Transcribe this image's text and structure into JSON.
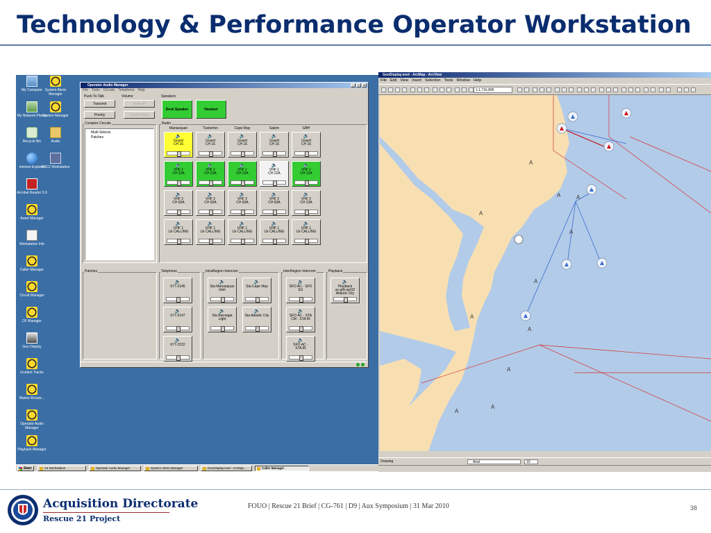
{
  "slide": {
    "title": "Technology & Performance Operator Workstation",
    "footer": "FOUO | Rescue 21 Brief | CG-761 | D9 | Aux Symposium | 31 Mar 2010",
    "page_number": "38",
    "org_name": "Acquisition Directorate",
    "org_sub": "Rescue 21 Project"
  },
  "desktop": {
    "icons": [
      {
        "label": "My Computer",
        "icon": "computer-icon"
      },
      {
        "label": "System Alerts Manager",
        "icon": "gear-icon"
      },
      {
        "label": "My Network Places",
        "icon": "network-icon"
      },
      {
        "label": "System Manager",
        "icon": "gear-icon"
      },
      {
        "label": "Recycle Bin",
        "icon": "recycle-bin-icon"
      },
      {
        "label": "Audio",
        "icon": "folder-icon"
      },
      {
        "label": "Internet Explorer",
        "icon": "ie-icon"
      },
      {
        "label": "DSC2 Workstation",
        "icon": "dsc-icon"
      },
      {
        "label": "Acrobat Reader 5.0",
        "icon": "acrobat-icon"
      },
      {
        "label": "Asset Manager",
        "icon": "gear-icon"
      },
      {
        "label": "Workstation Info",
        "icon": "document-icon"
      },
      {
        "label": "Caller Manager",
        "icon": "gear-icon"
      },
      {
        "label": "Circuit Manager",
        "icon": "gear-icon"
      },
      {
        "label": "DF Manager",
        "icon": "gear-icon"
      },
      {
        "label": "Geo Display",
        "icon": "geo-display-icon"
      },
      {
        "label": "Incident Tracks",
        "icon": "gear-icon"
      },
      {
        "label": "Marine Broadc...",
        "icon": "gear-icon"
      },
      {
        "label": "Operator Audio Manager",
        "icon": "gear-icon"
      },
      {
        "label": "Playback Manager",
        "icon": "gear-icon"
      }
    ]
  },
  "oam": {
    "title": "Operator Audio Manager",
    "menu": [
      "File",
      "Tools",
      "Circuits",
      "Telephone",
      "Help"
    ],
    "ptt_label": "Push-To-Talk",
    "transmit": "Transmit",
    "priority": "Priority",
    "volume_label": "Volume",
    "mute_all": "Mute All",
    "cancel_mute": "Cancel Mute",
    "speakers_label": "Speakers",
    "desk_speaker": "Desk Speaker",
    "headset": "Headset",
    "complex_label": "Complex Circuits",
    "tree": [
      "Multi Selects",
      "Patches"
    ],
    "radio_label": "Radio",
    "radio_cols": [
      "Manasquan",
      "Tuckerton",
      "Cape May",
      "Salem",
      "GBH"
    ],
    "radio_rows": [
      [
        {
          "l1": "Guard",
          "l2": "CH 16",
          "color": "yellow"
        },
        {
          "l1": "Guard",
          "l2": "CH 16",
          "color": "gray"
        },
        {
          "l1": "Guard",
          "l2": "CH 16",
          "color": "gray"
        },
        {
          "l1": "Guard",
          "l2": "CH 16",
          "color": "gray"
        },
        {
          "l1": "Guard",
          "l2": "CH 16",
          "color": "gray"
        }
      ],
      [
        {
          "l1": "VHF 1",
          "l2": "CH 22A",
          "color": "green"
        },
        {
          "l1": "VHF 1",
          "l2": "CH 22A",
          "color": "green"
        },
        {
          "l1": "VHF 1",
          "l2": "CH 22A",
          "color": "green"
        },
        {
          "l1": "VHF 1",
          "l2": "CH 22A",
          "color": "white"
        },
        {
          "l1": "VHF 1",
          "l2": "CH 22A",
          "color": "green"
        }
      ],
      [
        {
          "l1": "VHF 2",
          "l2": "CH 83A",
          "color": "gray"
        },
        {
          "l1": "VHF 2",
          "l2": "CH 83A",
          "color": "gray"
        },
        {
          "l1": "VHF 2",
          "l2": "CH 83A",
          "color": "gray"
        },
        {
          "l1": "VHF 2",
          "l2": "CH 83A",
          "color": "gray"
        },
        {
          "l1": "VHF 2",
          "l2": "CH 23A",
          "color": "gray"
        }
      ],
      [
        {
          "l1": "UHF 1",
          "l2": "LE CALLING",
          "color": "gray"
        },
        {
          "l1": "UHF 1",
          "l2": "LE CALLING",
          "color": "gray"
        },
        {
          "l1": "UHF 1",
          "l2": "LE CALLING",
          "color": "gray"
        },
        {
          "l1": "UHF 1",
          "l2": "LE CALLING",
          "color": "gray"
        },
        {
          "l1": "UHF 1",
          "l2": "LE CALLING",
          "color": "gray"
        }
      ]
    ],
    "patches_label": "Patches",
    "telephone_label": "Telephone",
    "telephone": [
      "677-2145",
      "677-2147",
      "677-2222"
    ],
    "intra_label": "IntraRegion Intercom",
    "intra": [
      [
        "Sta Manasquan",
        "Inlet"
      ],
      [
        "Sta Cape May",
        ""
      ],
      [
        "Sta Barnegat",
        "Light"
      ],
      [
        "Sta Atlantic City",
        ""
      ]
    ],
    "inter_label": "InterRegion Intercom",
    "inter": [
      [
        "SFO AC - SFO",
        "ES"
      ],
      [
        "SFO AC - STA",
        "CM - STA IR"
      ],
      [
        "SFO AC -",
        "STA IR"
      ]
    ],
    "playback_label": "Playback",
    "playback": [
      "Playback",
      "ac-g0t-opr02",
      "Atlantic City"
    ]
  },
  "taskbar": {
    "start": "Start",
    "items": [
      "V4 Workstation",
      "Operator Audio Manager",
      "System Alerts Manager",
      "GeoDisplay.mxd - ArcMap...",
      "Caller Manager"
    ]
  },
  "arcmap": {
    "title": "GeoDisplay.mxd - ArcMap - ArcView",
    "menu": [
      "File",
      "Edit",
      "View",
      "Insert",
      "Selection",
      "Tools",
      "Window",
      "Help"
    ],
    "scale": "1:1,716,895",
    "drawing": "Drawing",
    "font": "Arial",
    "font_size": "10",
    "colors": {
      "land": "#f8dfb2",
      "water": "#b2cbe8",
      "boundary": "#d83030",
      "track": "#3a6bd0"
    }
  }
}
